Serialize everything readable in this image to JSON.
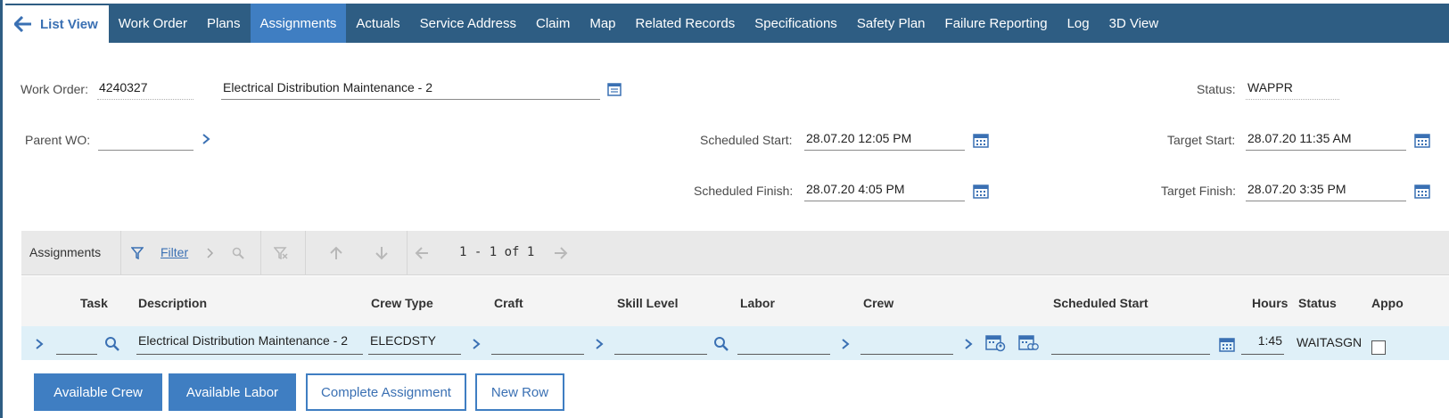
{
  "tabs": {
    "list_view": "List View",
    "items": [
      "Work Order",
      "Plans",
      "Assignments",
      "Actuals",
      "Service Address",
      "Claim",
      "Map",
      "Related Records",
      "Specifications",
      "Safety Plan",
      "Failure Reporting",
      "Log",
      "3D View"
    ],
    "active": "Assignments"
  },
  "header": {
    "work_order_label": "Work Order:",
    "work_order_value": "4240327",
    "description_value": "Electrical Distribution Maintenance - 2",
    "status_label": "Status:",
    "status_value": "WAPPR",
    "parent_wo_label": "Parent WO:",
    "parent_wo_value": "",
    "scheduled_start_label": "Scheduled Start:",
    "scheduled_start_value": "28.07.20 12:05 PM",
    "scheduled_finish_label": "Scheduled Finish:",
    "scheduled_finish_value": "28.07.20 4:05 PM",
    "target_start_label": "Target Start:",
    "target_start_value": "28.07.20 11:35 AM",
    "target_finish_label": "Target Finish:",
    "target_finish_value": "28.07.20 3:35 PM"
  },
  "assignments": {
    "title": "Assignments",
    "filter_label": "Filter",
    "pagination": "1 - 1 of 1",
    "columns": [
      "Task",
      "Description",
      "Crew Type",
      "Craft",
      "Skill Level",
      "Labor",
      "Crew",
      "Scheduled Start",
      "Hours",
      "Status",
      "Appo"
    ],
    "rows": [
      {
        "task": "",
        "description": "Electrical Distribution Maintenance - 2",
        "crew_type": "ELECDSTY",
        "craft": "",
        "skill_level": "",
        "labor": "",
        "crew": "",
        "scheduled_start": "",
        "hours": "1:45",
        "status": "WAITASGN",
        "appointment": false
      }
    ]
  },
  "buttons": {
    "available_crew": "Available Crew",
    "available_labor": "Available Labor",
    "complete_assignment": "Complete Assignment",
    "new_row": "New Row"
  },
  "colors": {
    "tabbar": "#2e5d83",
    "active_tab": "#3f7ec2",
    "link": "#3a70b3",
    "row_highlight": "#dff0f8"
  }
}
